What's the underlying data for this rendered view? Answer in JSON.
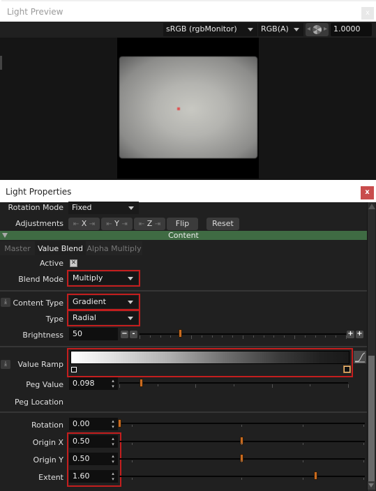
{
  "preview_window": {
    "title": "Light Preview",
    "close_label": "x",
    "toolbar": {
      "colorspace_value": "sRGB (rgbMonitor)",
      "channels_value": "RGB(A)",
      "exposure_icon": "aperture-icon",
      "exposure_value": "1.0000"
    }
  },
  "properties_window": {
    "title": "Light Properties",
    "close_label": "x",
    "rotation_mode": {
      "label": "Rotation Mode",
      "value": "Fixed"
    },
    "adjustments": {
      "label": "Adjustments",
      "buttons": [
        "X",
        "Y",
        "Z"
      ],
      "flip_label": "Flip",
      "reset_label": "Reset"
    },
    "section": {
      "title": "Content"
    },
    "tabs": [
      {
        "label": "Master",
        "active": false
      },
      {
        "label": "Value Blend",
        "active": true
      },
      {
        "label": "Alpha Multiply",
        "active": false
      }
    ],
    "active": {
      "label": "Active",
      "checked": true,
      "mark": "✕"
    },
    "blend_mode": {
      "label": "Blend Mode",
      "value": "Multiply"
    },
    "content_type": {
      "label": "Content Type",
      "value": "Gradient"
    },
    "type": {
      "label": "Type",
      "value": "Radial"
    },
    "brightness": {
      "label": "Brightness",
      "value": "50",
      "slider_fraction": 0.2
    },
    "value_ramp": {
      "label": "Value Ramp",
      "start_color": "#ffffff",
      "end_color": "#1a1a1a"
    },
    "peg_value": {
      "label": "Peg Value",
      "value": "0.098",
      "slider_fraction": 0.098
    },
    "peg_location": {
      "label": "Peg Location"
    },
    "rotation": {
      "label": "Rotation",
      "value": "0.00",
      "slider_fraction": 0.0
    },
    "origin_x": {
      "label": "Origin X",
      "value": "0.50",
      "slider_fraction": 0.5
    },
    "origin_y": {
      "label": "Origin Y",
      "value": "0.50",
      "slider_fraction": 0.5
    },
    "extent": {
      "label": "Extent",
      "value": "1.60",
      "slider_fraction": 0.8
    }
  },
  "colors": {
    "section_header": "#3f6b43",
    "highlight_box": "#c41e1e",
    "slider_handle": "#c96a1e",
    "close_button": "#c94c4c"
  }
}
